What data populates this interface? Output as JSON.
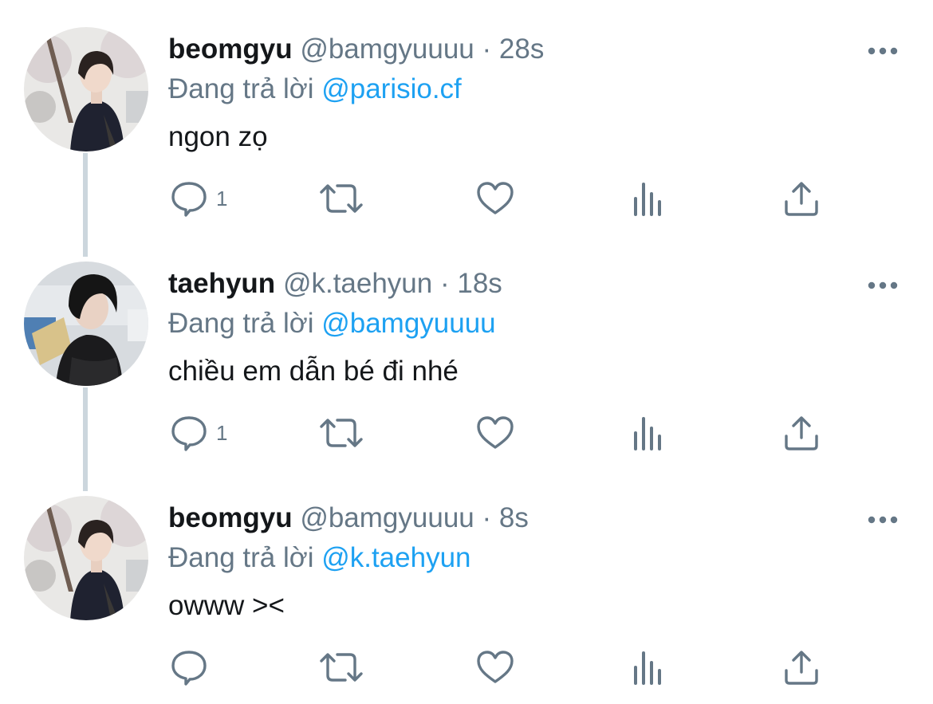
{
  "tweets": [
    {
      "name": "beomgyu",
      "handle": "@bamgyuuuu",
      "separator": "·",
      "time": "28s",
      "reply_prefix": "Đang trả lời",
      "reply_to": "@parisio.cf",
      "text": "ngon zọ",
      "reply_count": "1",
      "avatar": "avatar-beomgyu"
    },
    {
      "name": "taehyun",
      "handle": "@k.taehyun",
      "separator": "·",
      "time": "18s",
      "reply_prefix": "Đang trả lời",
      "reply_to": "@bamgyuuuu",
      "text": "chiều em dẫn bé đi nhé",
      "reply_count": "1",
      "avatar": "avatar-taehyun"
    },
    {
      "name": "beomgyu",
      "handle": "@bamgyuuuu",
      "separator": "·",
      "time": "8s",
      "reply_prefix": "Đang trả lời",
      "reply_to": "@k.taehyun",
      "text": "owww ><",
      "reply_count": "",
      "avatar": "avatar-beomgyu"
    }
  ],
  "icons": {
    "reply": "reply-icon",
    "retweet": "retweet-icon",
    "like": "like-icon",
    "analytics": "analytics-icon",
    "share": "share-icon",
    "more": "more-icon"
  },
  "colors": {
    "mention": "#1da1f2",
    "secondary_text": "#657786",
    "primary_text": "#14171a",
    "icon": "#657786",
    "thread_line": "#ccd6dd"
  }
}
